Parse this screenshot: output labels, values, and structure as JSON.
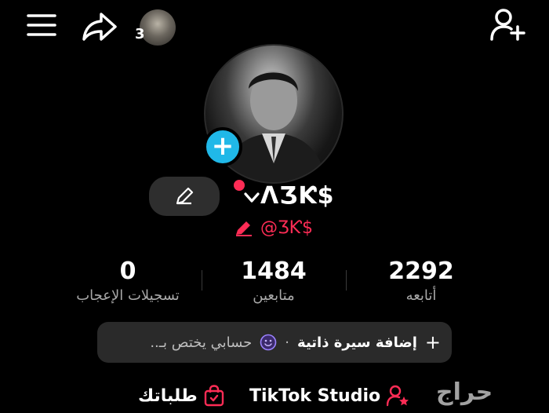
{
  "top": {
    "story_count": "3"
  },
  "profile": {
    "display_name": "ɅƷƘ$",
    "handle": "@ƷƘ$"
  },
  "stats": [
    {
      "value": "2292",
      "label": "أتابعه"
    },
    {
      "value": "1484",
      "label": "متابعين"
    },
    {
      "value": "0",
      "label": "تسجيلات الإعجاب"
    }
  ],
  "bio": {
    "add_label": "إضافة سيرة ذاتية",
    "placeholder": "حسابي يختص بـ.."
  },
  "bottom": {
    "studio_label": "TikTok Studio",
    "orders_label": "طلباتك"
  },
  "watermark": "حراج",
  "colors": {
    "accent": "#fe2c55",
    "add_button": "#20b8e8",
    "background": "#000000"
  },
  "icons": [
    "menu-icon",
    "share-icon",
    "add-user-icon",
    "pencil-icon",
    "emoji-icon",
    "bag-icon",
    "user-star-icon"
  ]
}
